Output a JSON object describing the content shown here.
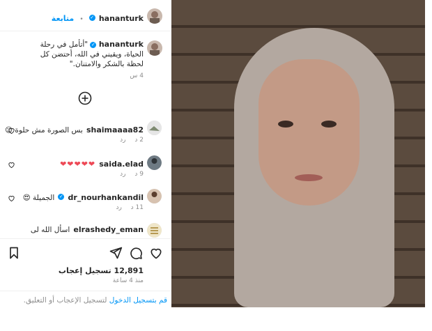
{
  "post": {
    "author": "hananturk",
    "follow_label": "متابعة",
    "caption": "\"أتأمل في رحلة الحياة، ويقيني في الله، أحتضن كل لحظة بالشكر والامتنان.\"",
    "caption_time": "4 س",
    "likes_count": "12,891",
    "likes_label": "تسجيل إعجاب",
    "posted_ago": "منذ 4 ساعة",
    "login_prompt_link": "قم بتسجيل الدخول",
    "login_prompt_rest": "لتسجيل الإعجاب أو التعليق."
  },
  "comments": [
    {
      "user": "shaimaaaa82",
      "verified": false,
      "text": "بس الصورة مش حلوة 😉",
      "time": "2 د",
      "reply": "رد"
    },
    {
      "user": "saida.elad",
      "verified": false,
      "text": "❤❤❤❤❤",
      "time": "9 د",
      "reply": "رد"
    },
    {
      "user": "dr_nourhankandil",
      "verified": true,
      "text": "الجميلة 😍",
      "time": "11 د",
      "reply": "رد"
    },
    {
      "user": "elrashedy_eman",
      "verified": false,
      "text": "اسأل الله لى ولكى",
      "time": "",
      "reply": ""
    }
  ],
  "icons": {
    "add": "plus-circle-icon",
    "like": "heart-icon",
    "comment": "comment-icon",
    "share": "send-icon",
    "save": "bookmark-icon"
  },
  "colors": {
    "link": "#0095f6",
    "verified": "#0095f6",
    "muted": "#8e8e8e",
    "heart": "#ed4956"
  }
}
